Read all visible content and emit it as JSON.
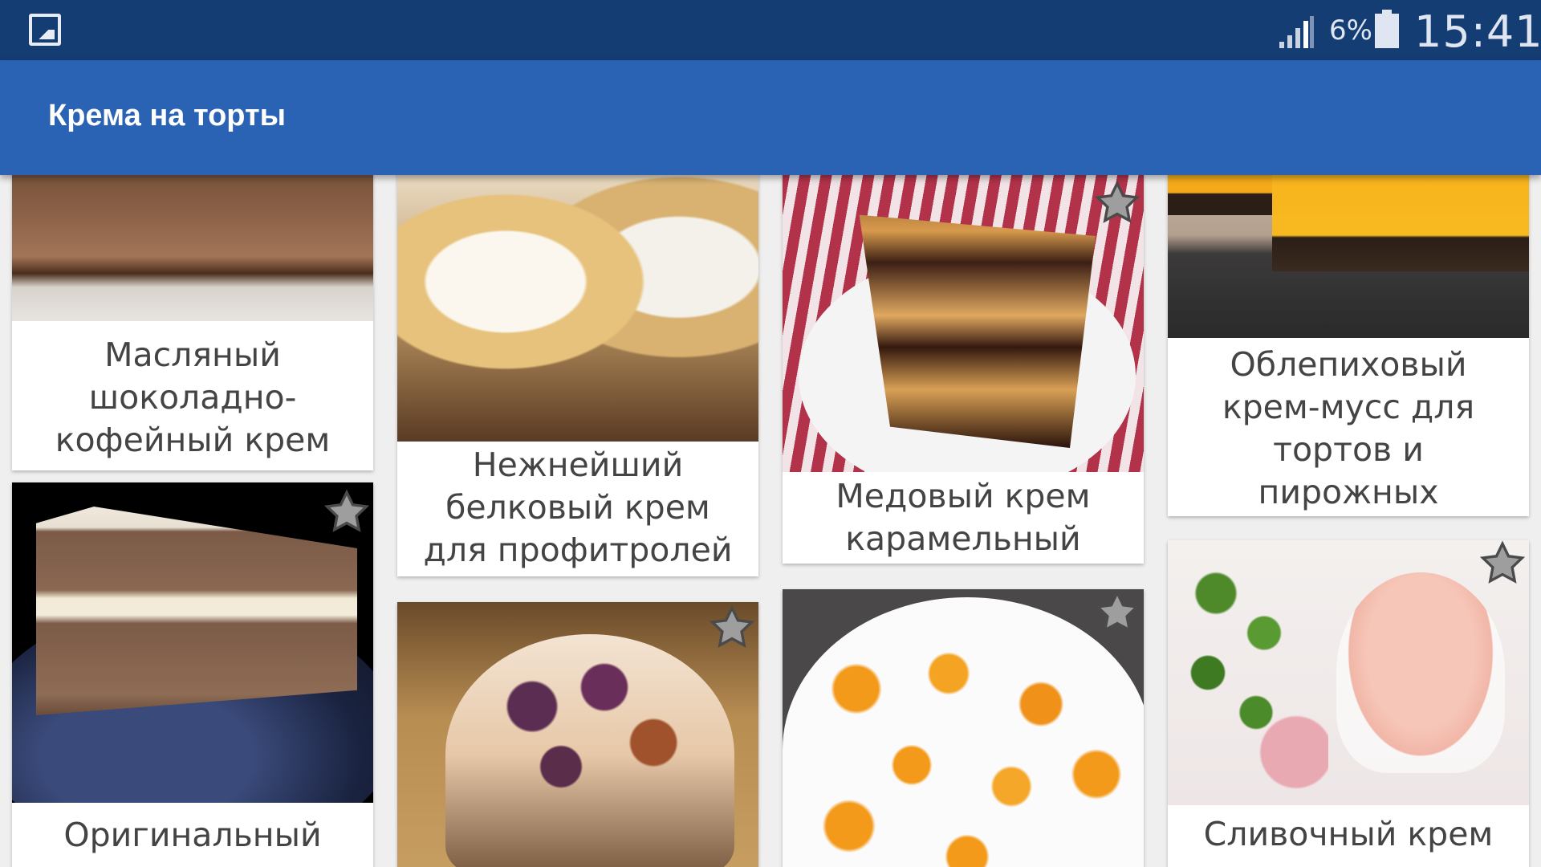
{
  "status_bar": {
    "battery_percent": "6%",
    "time": "15:41",
    "icons": [
      "gallery-icon",
      "signal-icon",
      "battery-icon"
    ]
  },
  "app_bar": {
    "title": "Крема на торты"
  },
  "colors": {
    "status_bar": "#143d74",
    "app_bar": "#2a63b4",
    "card_background": "#ffffff",
    "caption_text": "#444444",
    "star": "#9e9e9e"
  },
  "recipes": [
    {
      "title": "Масляный шоколадно-кофейный крем",
      "favorite_icon": "star-icon"
    },
    {
      "title": "Оригинальный крем с",
      "favorite_icon": "star-icon"
    },
    {
      "title": "Нежнейший белковый крем для профитролей",
      "favorite_icon": "star-icon"
    },
    {
      "title": "",
      "favorite_icon": "star-icon"
    },
    {
      "title": "Медовый крем карамельный",
      "favorite_icon": "star-icon"
    },
    {
      "title": "",
      "favorite_icon": "star-icon"
    },
    {
      "title": "Облепиховый крем-мусс для тортов и пирожных",
      "favorite_icon": "star-icon"
    },
    {
      "title": "Сливочный крем",
      "favorite_icon": "star-icon"
    }
  ]
}
